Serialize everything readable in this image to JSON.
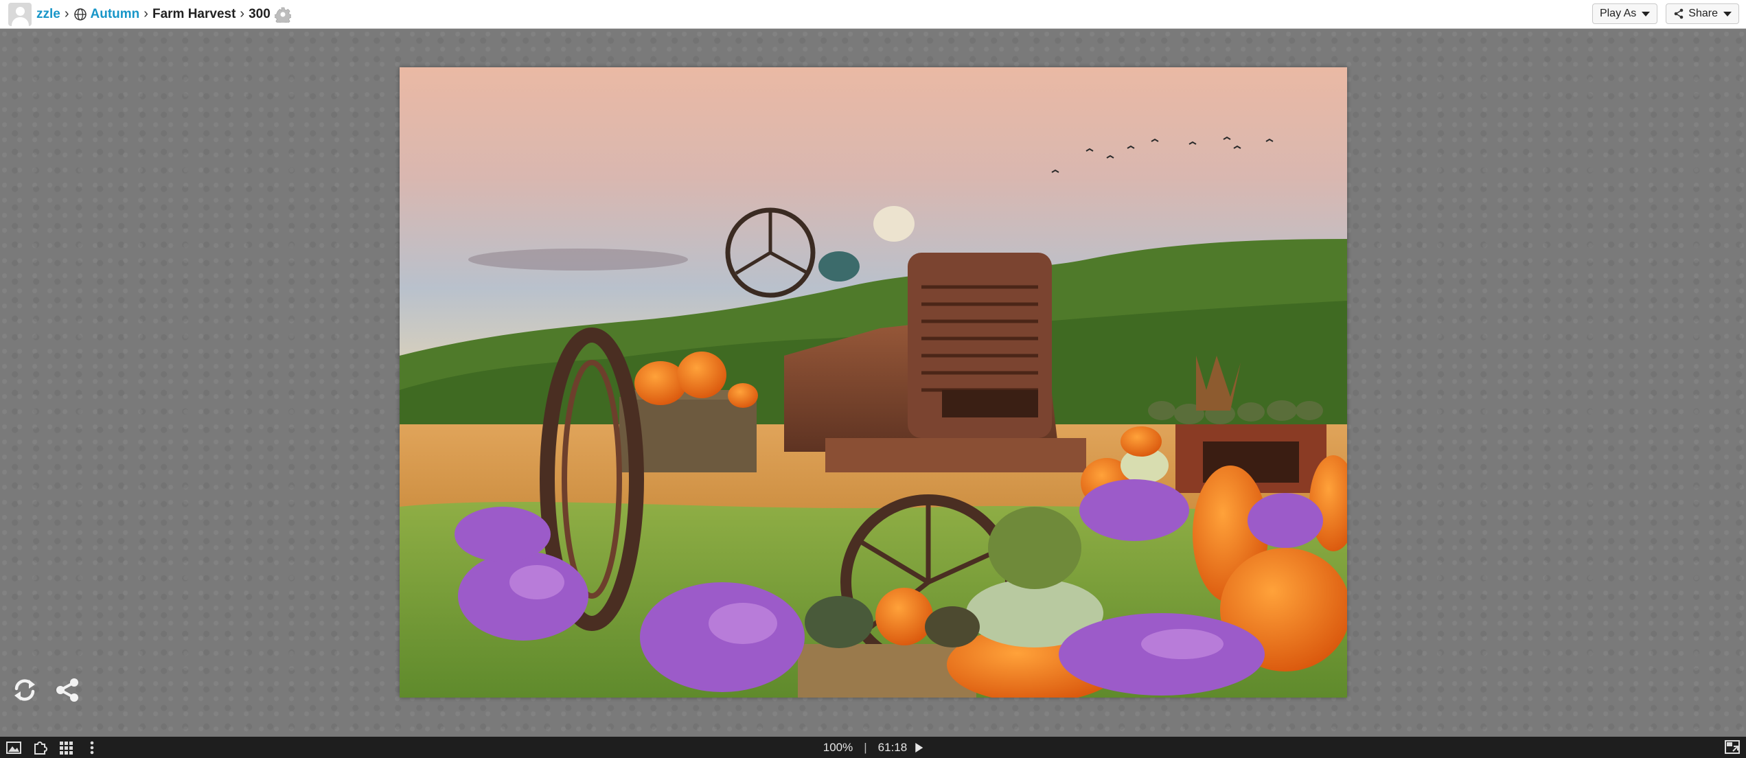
{
  "breadcrumb": {
    "user": "zzle",
    "category": "Autumn",
    "title": "Farm Harvest",
    "pieces": "300"
  },
  "toolbar": {
    "play_as_label": "Play As",
    "share_label": "Share"
  },
  "statusbar": {
    "zoom": "100%",
    "separator": "|",
    "timer": "61:18"
  },
  "icons": {
    "breadcrumb_globe": "globe-icon",
    "settings": "gear-icon",
    "share": "share-icon",
    "shuffle": "refresh-icon",
    "preview": "image-icon",
    "edges": "puzzle-piece-icon",
    "grid": "grid-icon",
    "menu": "more-vertical-icon",
    "play": "play-icon",
    "fullscreen": "fullscreen-icon"
  },
  "colors": {
    "link": "#1896c8",
    "statusbar_bg": "#1e1e1e",
    "workspace_bg": "#7a7a7a"
  }
}
